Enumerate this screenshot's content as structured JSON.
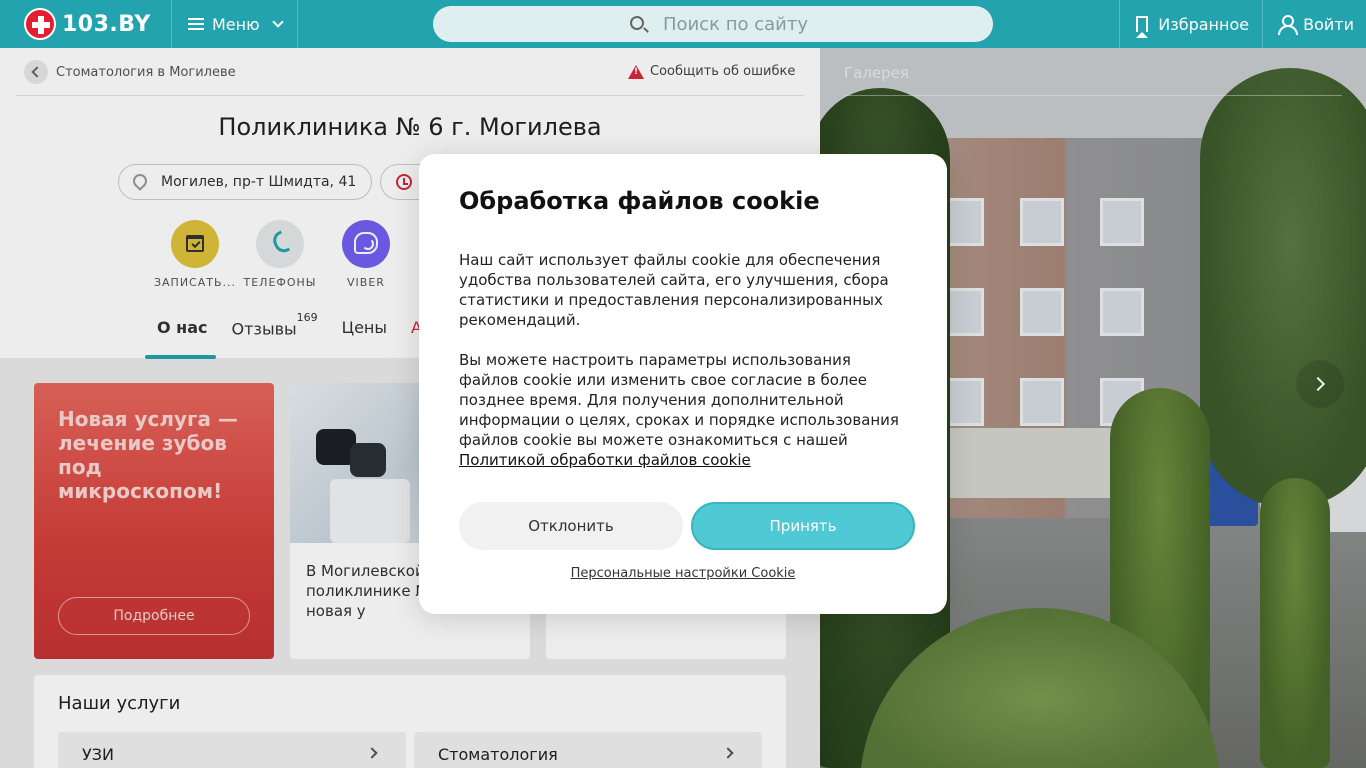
{
  "header": {
    "logo_text": "103.BY",
    "menu_label": "Меню",
    "search_placeholder": "Поиск по сайту",
    "favorites_label": "Избранное",
    "login_label": "Войти",
    "brand_color": "#22a3ad"
  },
  "breadcrumb": {
    "label": "Стоматология в Могилеве"
  },
  "report_error": {
    "label": "Сообщить об ошибке"
  },
  "clinic": {
    "title": "Поликлиника № 6 г. Могилева",
    "address": "Могилев, пр-т Шмидта, 41"
  },
  "actions": [
    {
      "label": "ЗАПИСАТЬ...",
      "icon": "calendar-check-icon",
      "color": "#e0c23a"
    },
    {
      "label": "ТЕЛЕФОНЫ",
      "icon": "phone-icon",
      "color": "#e6e9e9"
    },
    {
      "label": "VIBER",
      "icon": "viber-icon",
      "color": "#7360f2"
    }
  ],
  "tabs": [
    {
      "label": "О нас",
      "active": true
    },
    {
      "label": "Отзывы",
      "badge": "169"
    },
    {
      "label": "Цены"
    },
    {
      "label": "Ак"
    }
  ],
  "promo": {
    "title": "Новая услуга — лечение зубов под микроскопом!",
    "button": "Подробнее"
  },
  "news": {
    "text": "В Могилевской поликлинике № доступна новая у"
  },
  "services": {
    "title": "Наши услуги",
    "items": [
      "УЗИ",
      "Стоматология"
    ]
  },
  "gallery": {
    "title": "Галерея"
  },
  "cookie_modal": {
    "title": "Обработка файлов cookie",
    "paragraph1": "Наш сайт использует файлы cookie для обеспечения удобства пользователей сайта, его улучшения, сбора статистики и предоставления персонализированных рекомендаций.",
    "paragraph2": "Вы можете настроить параметры использования файлов cookie или изменить свое согласие в более позднее время. Для получения дополнительной информации о целях, сроках и порядке использования файлов cookie вы можете ознакомиться с нашей",
    "policy_link": "Политикой обработки файлов cookie",
    "decline_label": "Отклонить",
    "accept_label": "Принять",
    "custom_settings_label": "Персональные настройки Cookie",
    "accept_color": "#4fc9d3"
  }
}
